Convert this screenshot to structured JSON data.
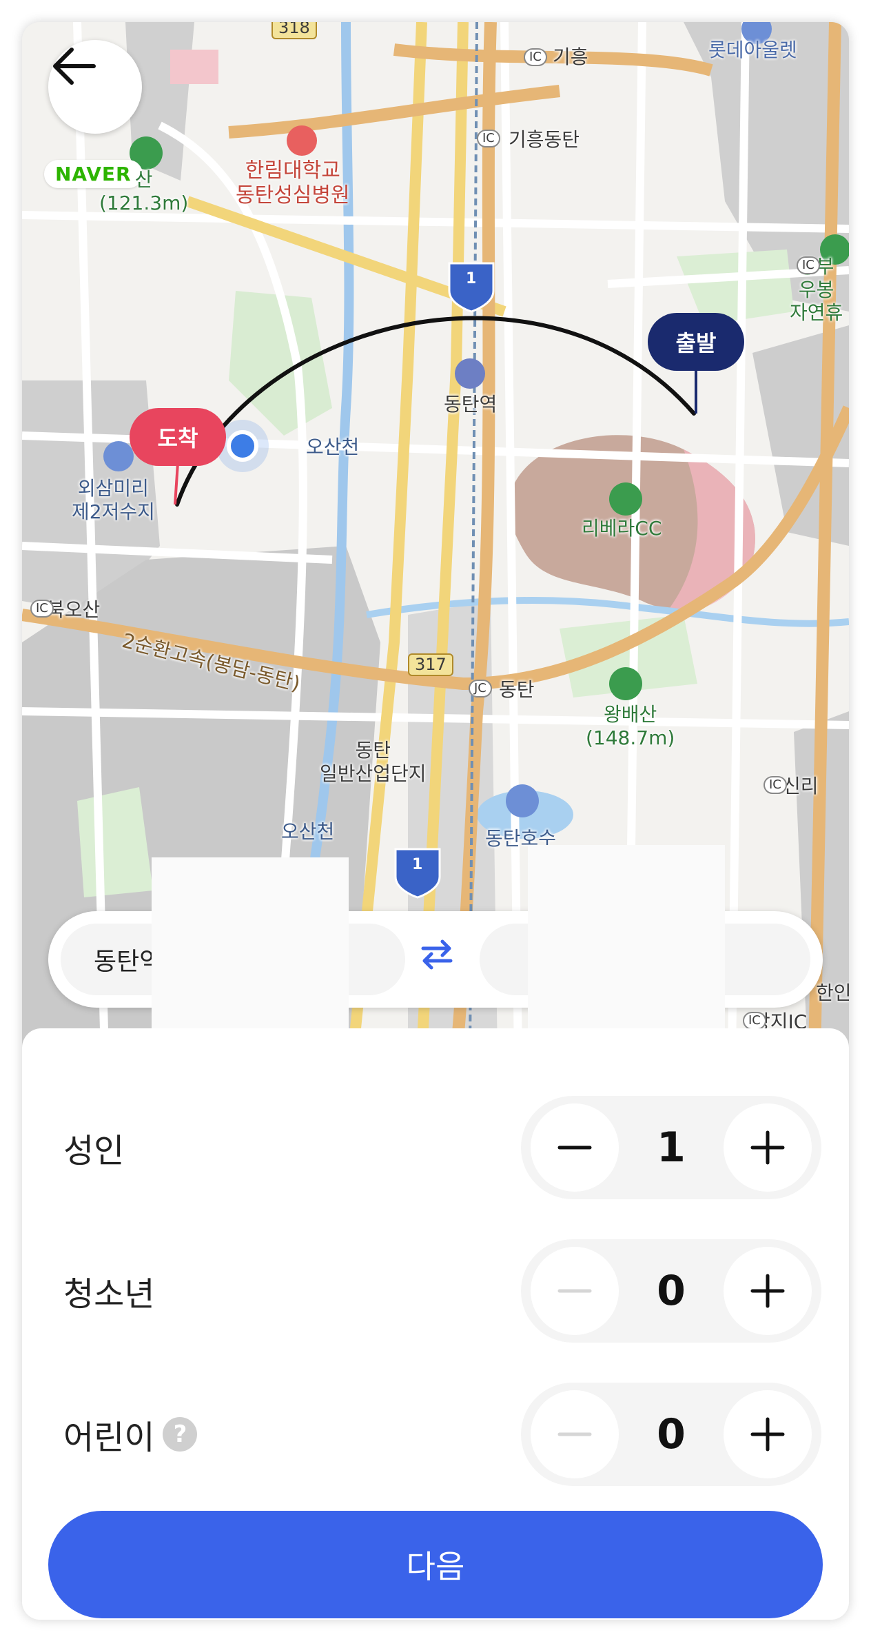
{
  "map": {
    "brand": "NAVER",
    "labels": {
      "road_318": "318",
      "giheung": "기흥",
      "lotte_outlet": "롯데아울렛",
      "giheung_dongtan": "기흥동탄",
      "hallym_hospital": "한림대학교\n동탄성심병원",
      "mountain_top_left": "산\n(121.3m)",
      "jungbu_ic": "중부\n우봉\n자연휴",
      "highway_1_top": "1",
      "dongtan_station": "동탄역",
      "osancheon_top": "오산천",
      "oesammi": "외삼미리\n제2저수지",
      "libera_cc": "리베라CC",
      "bukosan": "북오산",
      "ring_expressway": "2순환고속(봉담-동탄)",
      "road_317": "317",
      "dongtan_jc": "동탄",
      "wangbaesan": "왕배산\n(148.7m)",
      "dongtan_industrial": "동탄\n일반산업단지",
      "sinri": "신리",
      "osancheon_bottom": "오산천",
      "dongtan_lake": "동탄호수",
      "highway_1_bottom": "1",
      "hanil": "한인",
      "jangji_ic": "장지IC",
      "ic_badge": "IC",
      "jc_badge": "JC"
    },
    "start_pin": "출발",
    "end_pin": "도착"
  },
  "route": {
    "from": "동탄역 ...",
    "to": ""
  },
  "passengers": [
    {
      "label": "성인",
      "count": "1",
      "minus_enabled": true,
      "help": false
    },
    {
      "label": "청소년",
      "count": "0",
      "minus_enabled": false,
      "help": false
    },
    {
      "label": "어린이",
      "count": "0",
      "minus_enabled": false,
      "help": true
    }
  ],
  "help_icon_text": "?",
  "next_button": "다음",
  "colors": {
    "primary": "#3a63ea",
    "start_pin": "#1a2a6e",
    "end_pin": "#e8455e",
    "swap_icon": "#3a63ea"
  }
}
